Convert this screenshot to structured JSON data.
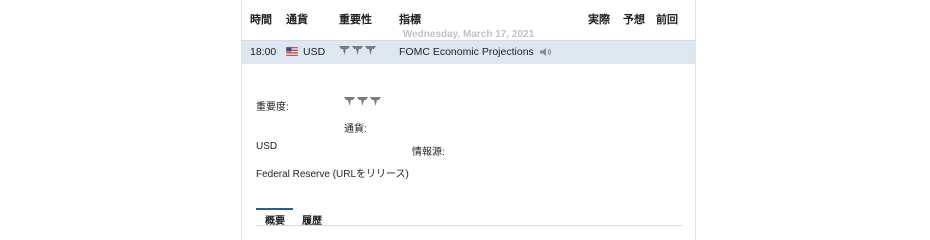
{
  "table_header": {
    "time": "時間",
    "currency": "通貨",
    "importance": "重要性",
    "indicator": "指標",
    "actual": "実際",
    "forecast": "予想",
    "previous": "前回"
  },
  "date_label": "Wednesday, March 17, 2021",
  "event": {
    "time": "18:00",
    "currency": "USD",
    "name": "FOMC Economic Projections",
    "importance_level": 3,
    "flag_icon": "us-flag-icon",
    "speaker_icon": "speaker-icon"
  },
  "details": {
    "importance_label": "重要度:",
    "currency_label": "通貨:",
    "currency_value": "USD",
    "source_label": "情報源:",
    "source_value": "Federal Reserve (URLをリリース)"
  },
  "tabs": [
    {
      "label": "概要",
      "active": true
    },
    {
      "label": "履歴",
      "active": false
    }
  ],
  "colors": {
    "row_highlight": "#dde7f1",
    "accent": "#2c5d8c",
    "bull_icon": "#7b7b7b",
    "date_text": "#c2c2c2"
  }
}
